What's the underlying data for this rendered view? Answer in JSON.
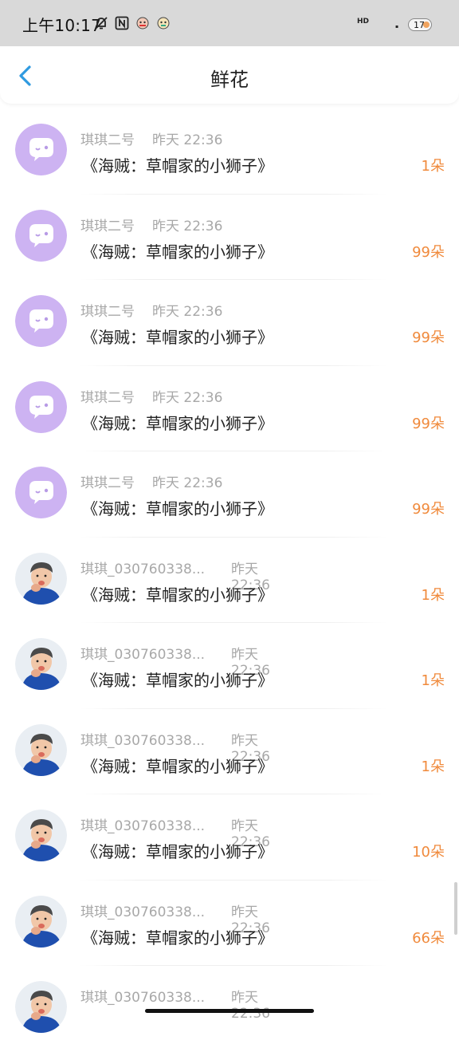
{
  "status_bar": {
    "time": "上午10:17",
    "network": "HD",
    "battery": "17"
  },
  "header": {
    "title": "鲜花"
  },
  "rows": [
    {
      "name": "琪琪二号",
      "time": "昨天 22:36",
      "title": "《海贼：草帽家的小狮子》",
      "count": "1朵",
      "avatar": "bubble"
    },
    {
      "name": "琪琪二号",
      "time": "昨天 22:36",
      "title": "《海贼：草帽家的小狮子》",
      "count": "99朵",
      "avatar": "bubble"
    },
    {
      "name": "琪琪二号",
      "time": "昨天 22:36",
      "title": "《海贼：草帽家的小狮子》",
      "count": "99朵",
      "avatar": "bubble"
    },
    {
      "name": "琪琪二号",
      "time": "昨天 22:36",
      "title": "《海贼：草帽家的小狮子》",
      "count": "99朵",
      "avatar": "bubble"
    },
    {
      "name": "琪琪二号",
      "time": "昨天 22:36",
      "title": "《海贼：草帽家的小狮子》",
      "count": "99朵",
      "avatar": "bubble"
    },
    {
      "name": "琪琪_030760338...",
      "time": "昨天 22:36",
      "title": "《海贼：草帽家的小狮子》",
      "count": "1朵",
      "avatar": "child"
    },
    {
      "name": "琪琪_030760338...",
      "time": "昨天 22:36",
      "title": "《海贼：草帽家的小狮子》",
      "count": "1朵",
      "avatar": "child"
    },
    {
      "name": "琪琪_030760338...",
      "time": "昨天 22:36",
      "title": "《海贼：草帽家的小狮子》",
      "count": "1朵",
      "avatar": "child"
    },
    {
      "name": "琪琪_030760338...",
      "time": "昨天 22:36",
      "title": "《海贼：草帽家的小狮子》",
      "count": "10朵",
      "avatar": "child"
    },
    {
      "name": "琪琪_030760338...",
      "time": "昨天 22:36",
      "title": "《海贼：草帽家的小狮子》",
      "count": "66朵",
      "avatar": "child"
    },
    {
      "name": "琪琪_030760338...",
      "time": "昨天 22:36",
      "title": "",
      "count": "",
      "avatar": "child"
    }
  ],
  "colors": {
    "accent_back": "#2f9ae0",
    "count": "#f08a3c",
    "meta": "#a8a8a8",
    "avatar_purple": "#cdb3f2"
  }
}
